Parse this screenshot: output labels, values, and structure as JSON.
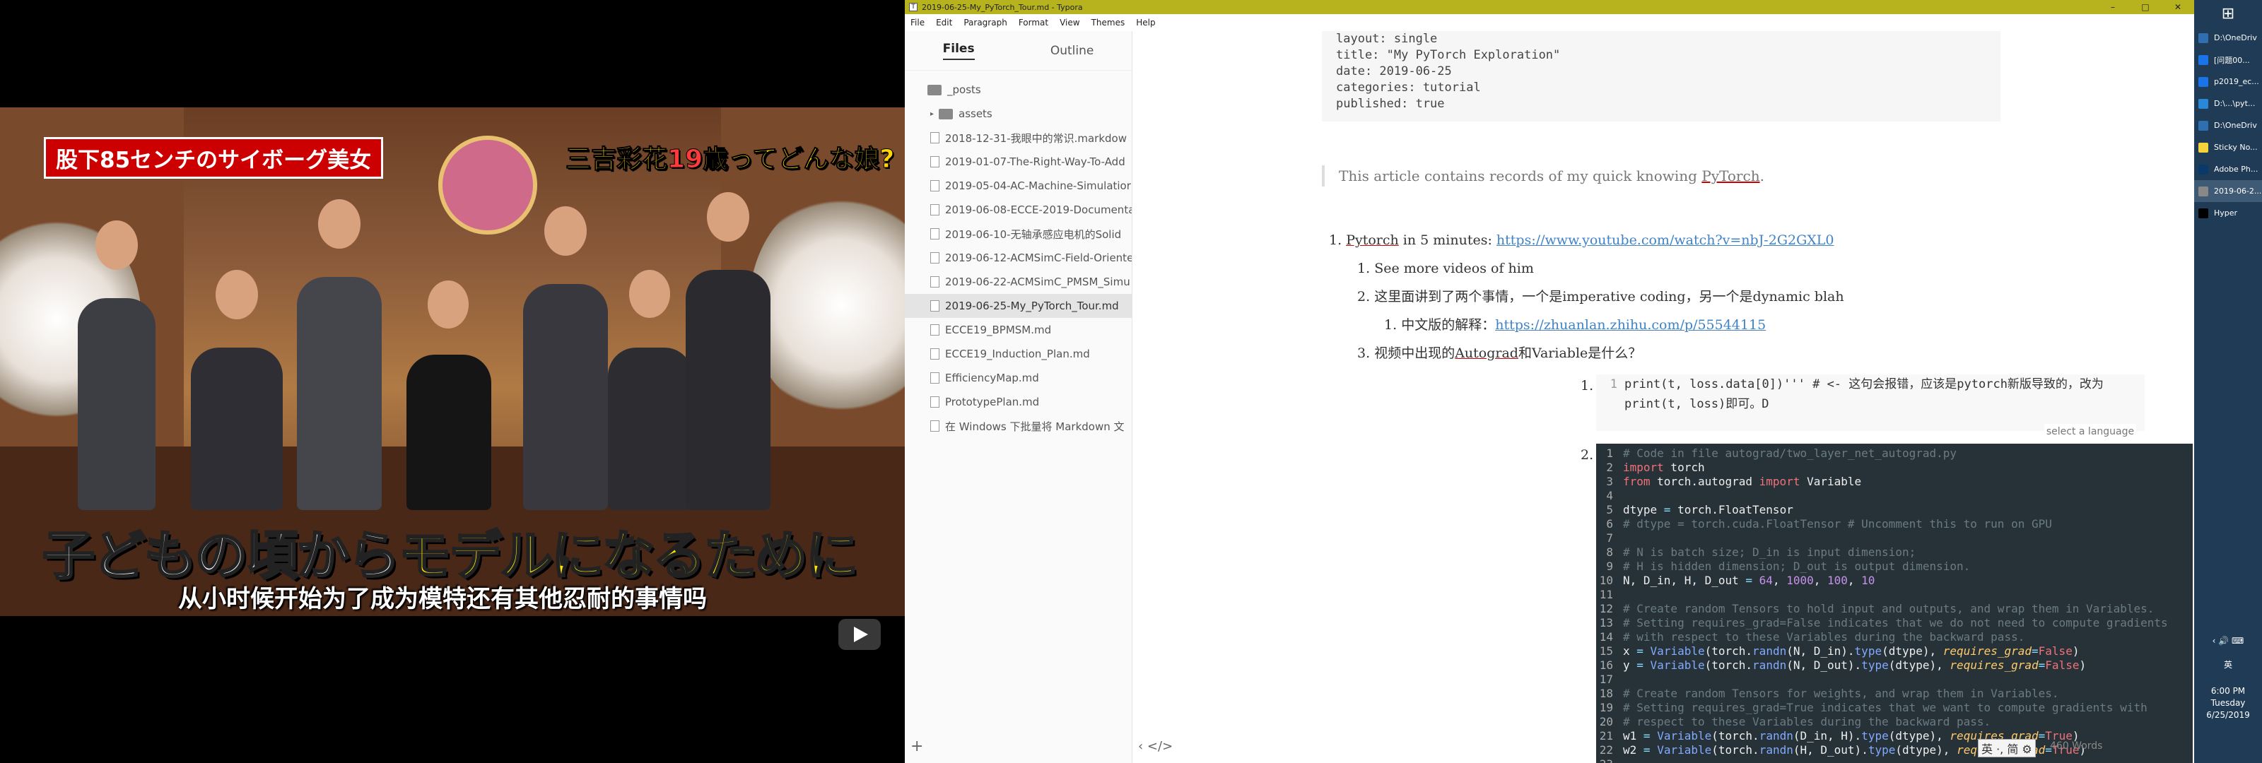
{
  "video": {
    "caption_top_left": "股下85センチのサイボーグ美女",
    "caption_top_right_a": "三吉彩花",
    "caption_top_right_num": "19",
    "caption_top_right_b": "歳ってどんな娘?",
    "caption_big_a": "子どもの頃から",
    "caption_big_b": "モデルになるために",
    "caption_subtitle": "从小时候开始为了成为模特还有其他忍耐的事情吗"
  },
  "window": {
    "title": "2019-06-25-My_PyTorch_Tour.md - Typora",
    "minimize": "–",
    "maximize": "□",
    "close": "✕"
  },
  "menu": [
    "File",
    "Edit",
    "Paragraph",
    "Format",
    "View",
    "Themes",
    "Help"
  ],
  "sidebar": {
    "tab_files": "Files",
    "tab_outline": "Outline",
    "items": [
      {
        "name": "_posts",
        "kind": "folder",
        "level": 0
      },
      {
        "name": "assets",
        "kind": "folder",
        "level": 1
      },
      {
        "name": "2018-12-31-我眼中的常识.markdow",
        "kind": "file",
        "level": 1
      },
      {
        "name": "2019-01-07-The-Right-Way-To-Add",
        "kind": "file",
        "level": 1
      },
      {
        "name": "2019-05-04-AC-Machine-Simulatior",
        "kind": "file",
        "level": 1
      },
      {
        "name": "2019-06-08-ECCE-2019-Documenta",
        "kind": "file",
        "level": 1
      },
      {
        "name": "2019-06-10-无轴承感应电机的Solid",
        "kind": "file",
        "level": 1
      },
      {
        "name": "2019-06-12-ACMSimC-Field-Oriente",
        "kind": "file",
        "level": 1
      },
      {
        "name": "2019-06-22-ACMSimC_PMSM_Simu",
        "kind": "file",
        "level": 1
      },
      {
        "name": "2019-06-25-My_PyTorch_Tour.md",
        "kind": "file",
        "level": 1,
        "selected": true
      },
      {
        "name": "ECCE19_BPMSM.md",
        "kind": "file",
        "level": 1
      },
      {
        "name": "ECCE19_Induction_Plan.md",
        "kind": "file",
        "level": 1
      },
      {
        "name": "EfficiencyMap.md",
        "kind": "file",
        "level": 1
      },
      {
        "name": "PrototypePlan.md",
        "kind": "file",
        "level": 1
      },
      {
        "name": "在 Windows 下批量将 Markdown 文",
        "kind": "file",
        "level": 1
      }
    ],
    "add": "+"
  },
  "editor": {
    "frontmatter": [
      "layout: single",
      "title:  \"My PyTorch Exploration\"",
      "date:   2019-06-25",
      "categories: tutorial",
      "published: true"
    ],
    "quote_a": "This article contains records of my quick knowing ",
    "quote_link": "PyTorch",
    "quote_b": ".",
    "l1_num": "1.",
    "l1_a": "Pytorch",
    "l1_b": " in 5 minutes: ",
    "l1_url": "https://www.youtube.com/watch?v=nbJ-2G2GXL0",
    "l2a_num": "1.",
    "l2a": "See more videos of him",
    "l2b_num": "2.",
    "l2b": "这里面讲到了两个事情，一个是imperative coding，另一个是dynamic blah",
    "l3_num": "1.",
    "l3_a": "中文版的解释：",
    "l3_url": "https://zhuanlan.zhihu.com/p/55544115",
    "l2c_num": "3.",
    "l2c_a": "视频中出现的",
    "l2c_b": "Autograd",
    "l2c_c": "和Variable是什么？",
    "c1_num": "1.",
    "c1_ln": "1",
    "c1_code": "print(t, loss.data[0])''' # <- 这句会报错，应该是pytorch新版导致的，改为print(t, loss)即可。D",
    "c2_num": "2.",
    "lang_hint": "select a language",
    "code_lines": [
      {
        "n": "1",
        "t": "# Code in file autograd/two_layer_net_autograd.py",
        "c": "cm"
      },
      {
        "n": "2",
        "parts": [
          [
            "import",
            "kw"
          ],
          [
            " torch",
            ""
          ]
        ]
      },
      {
        "n": "3",
        "parts": [
          [
            "from",
            "kw"
          ],
          [
            " torch.autograd ",
            ""
          ],
          [
            "import",
            "kw"
          ],
          [
            " Variable",
            ""
          ]
        ]
      },
      {
        "n": "4",
        "t": "",
        "c": ""
      },
      {
        "n": "5",
        "parts": [
          [
            "dtype ",
            ""
          ],
          [
            "=",
            "op"
          ],
          [
            " torch.FloatTensor",
            ""
          ]
        ]
      },
      {
        "n": "6",
        "t": "# dtype = torch.cuda.FloatTensor # Uncomment this to run on GPU",
        "c": "cm"
      },
      {
        "n": "7",
        "t": "",
        "c": ""
      },
      {
        "n": "8",
        "t": "# N is batch size; D_in is input dimension;",
        "c": "cm"
      },
      {
        "n": "9",
        "t": "# H is hidden dimension; D_out is output dimension.",
        "c": "cm"
      },
      {
        "n": "10",
        "parts": [
          [
            "N, D_in, H, D_out ",
            ""
          ],
          [
            "=",
            "op"
          ],
          [
            " ",
            ""
          ],
          [
            "64",
            "nm"
          ],
          [
            ", ",
            ""
          ],
          [
            "1000",
            "nm"
          ],
          [
            ", ",
            ""
          ],
          [
            "100",
            "nm"
          ],
          [
            ", ",
            ""
          ],
          [
            "10",
            "nm"
          ]
        ]
      },
      {
        "n": "11",
        "t": "",
        "c": ""
      },
      {
        "n": "12",
        "t": "# Create random Tensors to hold input and outputs, and wrap them in Variables.",
        "c": "cm"
      },
      {
        "n": "13",
        "t": "# Setting requires_grad=False indicates that we do not need to compute gradients",
        "c": "cm"
      },
      {
        "n": "14",
        "t": "# with respect to these Variables during the backward pass.",
        "c": "cm"
      },
      {
        "n": "15",
        "parts": [
          [
            "x ",
            ""
          ],
          [
            "=",
            "op"
          ],
          [
            " ",
            ""
          ],
          [
            "Variable",
            "fn"
          ],
          [
            "(torch.",
            ""
          ],
          [
            "randn",
            "fn"
          ],
          [
            "(N, D_in).",
            ""
          ],
          [
            "type",
            "fn"
          ],
          [
            "(dtype), ",
            ""
          ],
          [
            "requires_grad",
            "it"
          ],
          [
            "=",
            "op"
          ],
          [
            "False",
            "kw"
          ],
          [
            ")",
            ""
          ]
        ]
      },
      {
        "n": "16",
        "parts": [
          [
            "y ",
            ""
          ],
          [
            "=",
            "op"
          ],
          [
            " ",
            ""
          ],
          [
            "Variable",
            "fn"
          ],
          [
            "(torch.",
            ""
          ],
          [
            "randn",
            "fn"
          ],
          [
            "(N, D_out).",
            ""
          ],
          [
            "type",
            "fn"
          ],
          [
            "(dtype), ",
            ""
          ],
          [
            "requires_grad",
            "it"
          ],
          [
            "=",
            "op"
          ],
          [
            "False",
            "kw"
          ],
          [
            ")",
            ""
          ]
        ]
      },
      {
        "n": "17",
        "t": "",
        "c": ""
      },
      {
        "n": "18",
        "t": "# Create random Tensors for weights, and wrap them in Variables.",
        "c": "cm"
      },
      {
        "n": "19",
        "t": "# Setting requires_grad=True indicates that we want to compute gradients with",
        "c": "cm"
      },
      {
        "n": "20",
        "t": "# respect to these Variables during the backward pass.",
        "c": "cm"
      },
      {
        "n": "21",
        "parts": [
          [
            "w1 ",
            ""
          ],
          [
            "=",
            "op"
          ],
          [
            " ",
            ""
          ],
          [
            "Variable",
            "fn"
          ],
          [
            "(torch.",
            ""
          ],
          [
            "randn",
            "fn"
          ],
          [
            "(D_in, H).",
            ""
          ],
          [
            "type",
            "fn"
          ],
          [
            "(dtype), ",
            ""
          ],
          [
            "requires_grad",
            "it"
          ],
          [
            "=",
            "op"
          ],
          [
            "True",
            "kw"
          ],
          [
            ")",
            ""
          ]
        ]
      },
      {
        "n": "22",
        "parts": [
          [
            "w2 ",
            ""
          ],
          [
            "=",
            "op"
          ],
          [
            " ",
            ""
          ],
          [
            "Variable",
            "fn"
          ],
          [
            "(torch.",
            ""
          ],
          [
            "randn",
            "fn"
          ],
          [
            "(H, D_out).",
            ""
          ],
          [
            "type",
            "fn"
          ],
          [
            "(dtype), ",
            ""
          ],
          [
            "requires_grad",
            "it"
          ],
          [
            "=",
            "op"
          ],
          [
            "True",
            "kw"
          ],
          [
            ")",
            ""
          ]
        ]
      },
      {
        "n": "23",
        "t": "",
        "c": ""
      }
    ],
    "footer_left": "‹  </>",
    "ime": "英 ·, 简 ⚙",
    "word_count": "460 Words"
  },
  "taskbar": {
    "items": [
      {
        "label": "D:\\OneDriv",
        "color": "#2f6fb0"
      },
      {
        "label": "[问题00...",
        "color": "#1a73e8"
      },
      {
        "label": "p2019_ec...",
        "color": "#1a73e8"
      },
      {
        "label": "D:\\...\\pyt...",
        "color": "#2b88d8"
      },
      {
        "label": "D:\\OneDriv",
        "color": "#2f6fb0"
      },
      {
        "label": "Sticky No...",
        "color": "#f5d33b"
      },
      {
        "label": "Adobe Ph...",
        "color": "#0b3a6a"
      },
      {
        "label": "2019-06-2...",
        "color": "#888",
        "active": true
      },
      {
        "label": "Hyper",
        "color": "#000"
      }
    ],
    "tray": "‹  🔊  ⌨",
    "ime": "英",
    "time": "6:00 PM",
    "day": "Tuesday",
    "date": "6/25/2019"
  }
}
